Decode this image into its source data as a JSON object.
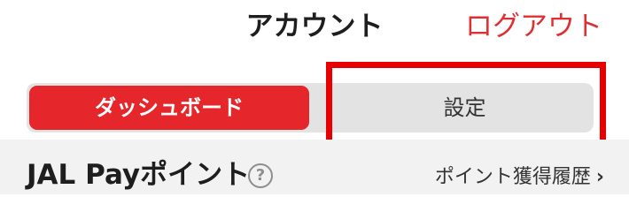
{
  "header": {
    "title": "アカウント",
    "logout_label": "ログアウト"
  },
  "tabs": [
    {
      "label": "ダッシュボード",
      "active": true
    },
    {
      "label": "設定",
      "active": false
    }
  ],
  "section": {
    "title": "JAL Payポイント",
    "help_icon": "?",
    "history_link_label": "ポイント獲得履歴",
    "chevron": "›"
  },
  "colors": {
    "accent": "#e5272b",
    "logout_text": "#e02f32",
    "highlight_border": "#e80000",
    "tab_background": "#e3e3e3",
    "section_background": "#f2f2f3"
  }
}
